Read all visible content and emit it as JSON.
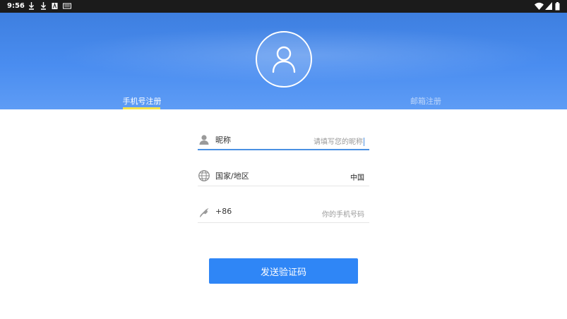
{
  "status_bar": {
    "time": "9:56",
    "left_icons": [
      "download-icon",
      "download-icon",
      "a-badge-icon",
      "sd-card-icon"
    ],
    "right_icons": [
      "wifi-icon",
      "signal-icon",
      "battery-icon"
    ]
  },
  "header": {
    "avatar_icon": "person-icon",
    "tabs": [
      {
        "label": "手机号注册",
        "active": true
      },
      {
        "label": "邮箱注册",
        "active": false
      }
    ],
    "accent": "#f4e34a"
  },
  "form": {
    "nickname": {
      "label": "昵称",
      "placeholder": "请填写您的昵称",
      "icon": "person-icon"
    },
    "region": {
      "label": "国家/地区",
      "value": "中国",
      "icon": "globe-icon"
    },
    "phone": {
      "label": "+86",
      "placeholder": "你的手机号码",
      "icon": "phone-icon"
    },
    "submit_label": "发送验证码"
  },
  "colors": {
    "primary": "#2f86f6",
    "header": "#4a8df0"
  }
}
